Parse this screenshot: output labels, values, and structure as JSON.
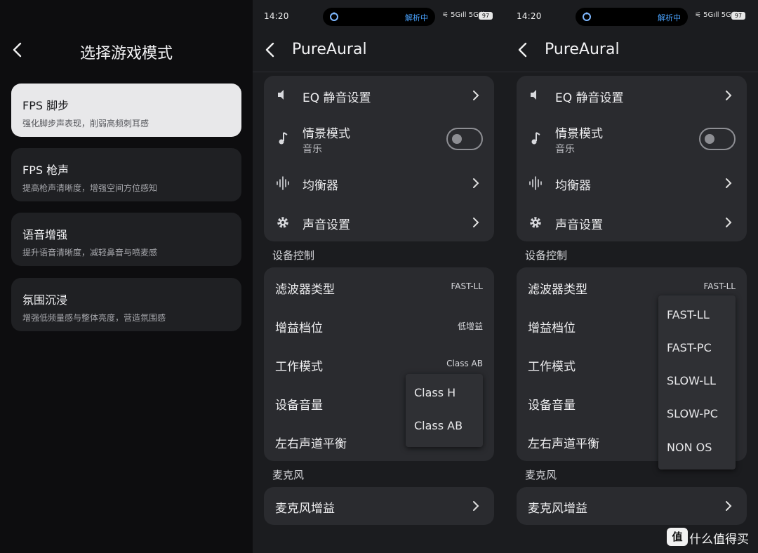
{
  "panel1": {
    "title": "选择游戏模式",
    "modes": [
      {
        "title": "FPS 脚步",
        "desc": "强化脚步声表现，削弱高频刺耳感",
        "selected": true
      },
      {
        "title": "FPS 枪声",
        "desc": "提高枪声清晰度，增强空间方位感知",
        "selected": false
      },
      {
        "title": "语音增强",
        "desc": "提升语音清晰度，减轻鼻音与喷麦感",
        "selected": false
      },
      {
        "title": "氛围沉浸",
        "desc": "增强低频量感与整体亮度，营造氛围感",
        "selected": false
      }
    ]
  },
  "status": {
    "time": "14:20",
    "pill_text": "解析中",
    "battery": "97",
    "signal": "⚟ 5Gıll 5Gıll"
  },
  "app": {
    "title": "PureAural",
    "eq_mute": "EQ 静音设置",
    "scene_mode": "情景模式",
    "scene_mode_value": "音乐",
    "equalizer": "均衡器",
    "sound_settings": "声音设置",
    "device_control": "设备控制",
    "filter_type": "滤波器类型",
    "filter_type_value": "FAST-LL",
    "gain_level": "增益档位",
    "gain_level_value": "低增益",
    "work_mode": "工作模式",
    "work_mode_value": "Class AB",
    "device_volume": "设备音量",
    "balance": "左右声道平衡",
    "microphone": "麦克风",
    "mic_gain": "麦克风增益"
  },
  "menu_work_mode": [
    "Class H",
    "Class AB"
  ],
  "menu_filter_type": [
    "FAST-LL",
    "FAST-PC",
    "SLOW-LL",
    "SLOW-PC",
    "NON OS"
  ],
  "watermark": {
    "logo": "值",
    "text": "什么值得买"
  },
  "colors": {
    "accent": "#4aa3ff",
    "card": "#2a2b2f",
    "bg": "#1b1c1f"
  }
}
